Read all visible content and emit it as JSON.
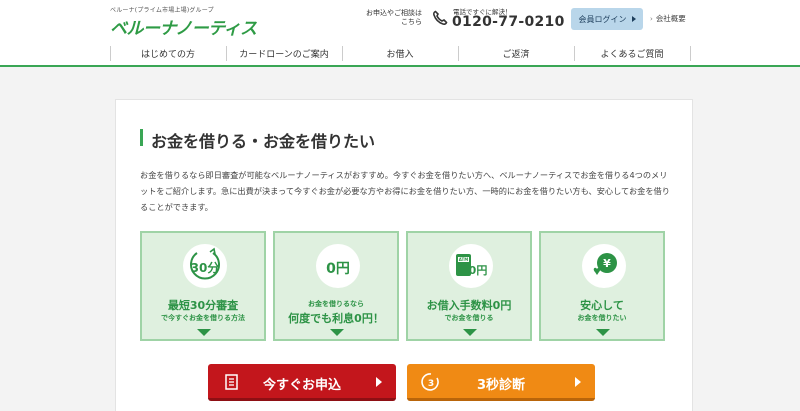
{
  "header": {
    "brand_sub": "ベルーナ(プライム市場上場)グループ",
    "logo": "ベルーナノーティス",
    "contact_label": "お申込やご相談は\nこちら",
    "phone_caption": "電話ですぐに解決！",
    "phone_number": "0120-77-0210",
    "login_label": "会員ログイン",
    "company_label": "会社概要"
  },
  "nav": {
    "items": [
      {
        "label": "はじめての方"
      },
      {
        "label": "カードローンのご案内"
      },
      {
        "label": "お借入"
      },
      {
        "label": "ご返済"
      },
      {
        "label": "よくあるご質問"
      }
    ]
  },
  "main": {
    "title": "お金を借りる・お金を借りたい",
    "intro": "お金を借りるなら即日審査が可能なベルーナノーティスがおすすめ。今すぐお金を借りたい方へ、ベルーナノーティスでお金を借りる4つのメリットをご紹介します。急に出費が決まって今すぐお金が必要な方やお得にお金を借りたい方、一時的にお金を借りたい方も、安心してお金を借りることができます。",
    "features": [
      {
        "icon": "clock-30min-icon",
        "icon_text": "30分",
        "main": "最短30分審査",
        "sub": "で今すぐお金を借りる方法",
        "sub_first": false
      },
      {
        "icon": "zero-yen-icon",
        "icon_text": "0円",
        "pre": "お金を借りるなら",
        "main": "何度でも利息0円！"
      },
      {
        "icon": "atm-zero-yen-icon",
        "icon_text": "0円",
        "atm_text": "ATM",
        "main": "お借入手数料0円",
        "sub": "でお金を借りる"
      },
      {
        "icon": "yen-heart-icon",
        "icon_text": "¥",
        "main": "安心して",
        "sub": "お金を借りたい"
      }
    ],
    "cta_apply": "今すぐお申込",
    "cta_diagnosis": "3秒診断",
    "cta_diagnosis_icon_text": "3"
  },
  "colors": {
    "accent_green": "#3aa655",
    "feature_bg": "#dff0df",
    "cta_red": "#c3161c",
    "cta_orange": "#f08a14",
    "login_bg": "#b9d6ea"
  }
}
